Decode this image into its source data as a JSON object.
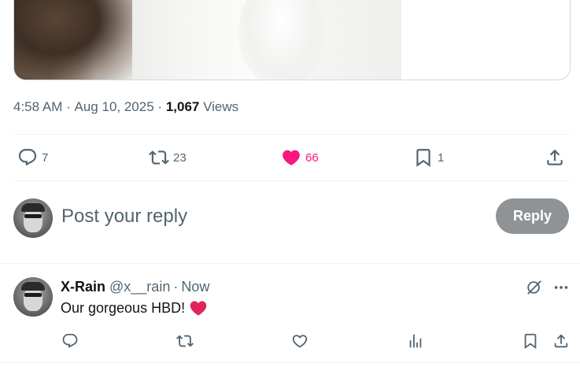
{
  "media": {
    "icon": "photo"
  },
  "tweet_meta": {
    "time": "4:58 AM",
    "dot1": "·",
    "date": "Aug 10, 2025",
    "dot2": "·",
    "views_count": "1,067",
    "views_label": "Views"
  },
  "actions": {
    "replies": "7",
    "reposts": "23",
    "likes": "66",
    "bookmarks": "1"
  },
  "colors": {
    "like_active": "#f91880",
    "reply_button_bg": "#8f9396",
    "secondary_text": "#536471",
    "heart_emoji": "#e0245e"
  },
  "compose": {
    "placeholder": "Post your reply",
    "reply_button": "Reply"
  },
  "reply": {
    "name": "X-Rain",
    "handle": "@x__rain",
    "sep": "·",
    "time": "Now",
    "text": "Our gorgeous HBD!",
    "emoji": "red-heart"
  }
}
